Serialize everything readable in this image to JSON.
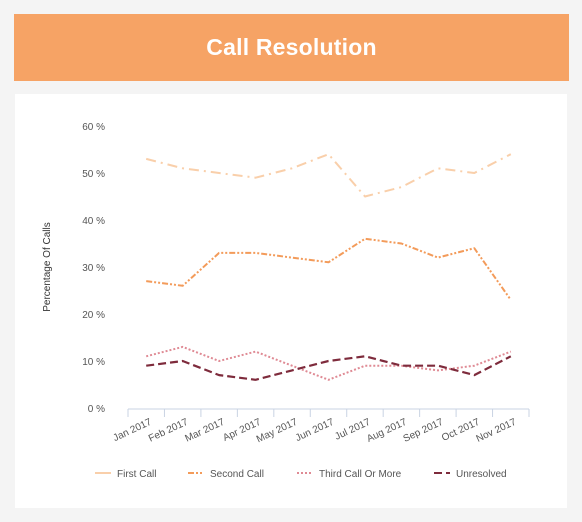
{
  "header": {
    "title": "Call Resolution"
  },
  "colors": {
    "banner": "#f6a365",
    "first_call": "#f9cfaa",
    "second_call": "#f39b5a",
    "third_call": "#df8a94",
    "unresolved": "#7e2b3c"
  },
  "chart_data": {
    "type": "line",
    "title": "Call Resolution",
    "xlabel": "",
    "ylabel": "Percentage Of Calls",
    "ylim": [
      0,
      60
    ],
    "yticks": [
      "0 %",
      "10 %",
      "20 %",
      "30 %",
      "40 %",
      "50 %",
      "60 %"
    ],
    "ytick_values": [
      0,
      10,
      20,
      30,
      40,
      50,
      60
    ],
    "grid": false,
    "legend_position": "bottom",
    "categories": [
      "Jan 2017",
      "Feb 2017",
      "Mar 2017",
      "Apr 2017",
      "May 2017",
      "Jun 2017",
      "Jul 2017",
      "Aug 2017",
      "Sep 2017",
      "Oct 2017",
      "Nov 2017"
    ],
    "series": [
      {
        "name": "First Call",
        "style": "dash-dot",
        "values": [
          53,
          51,
          50,
          49,
          51,
          54,
          45,
          47,
          51,
          50,
          54
        ]
      },
      {
        "name": "Second Call",
        "style": "dash-dot-dot",
        "values": [
          27,
          26,
          33,
          33,
          32,
          31,
          36,
          35,
          32,
          34,
          23
        ]
      },
      {
        "name": "Third Call Or More",
        "style": "dotted",
        "values": [
          11,
          13,
          10,
          12,
          9,
          6,
          9,
          9,
          8,
          9,
          12
        ]
      },
      {
        "name": "Unresolved",
        "style": "dashed",
        "values": [
          9,
          10,
          7,
          6,
          8,
          10,
          11,
          9,
          9,
          7,
          11
        ]
      }
    ]
  }
}
